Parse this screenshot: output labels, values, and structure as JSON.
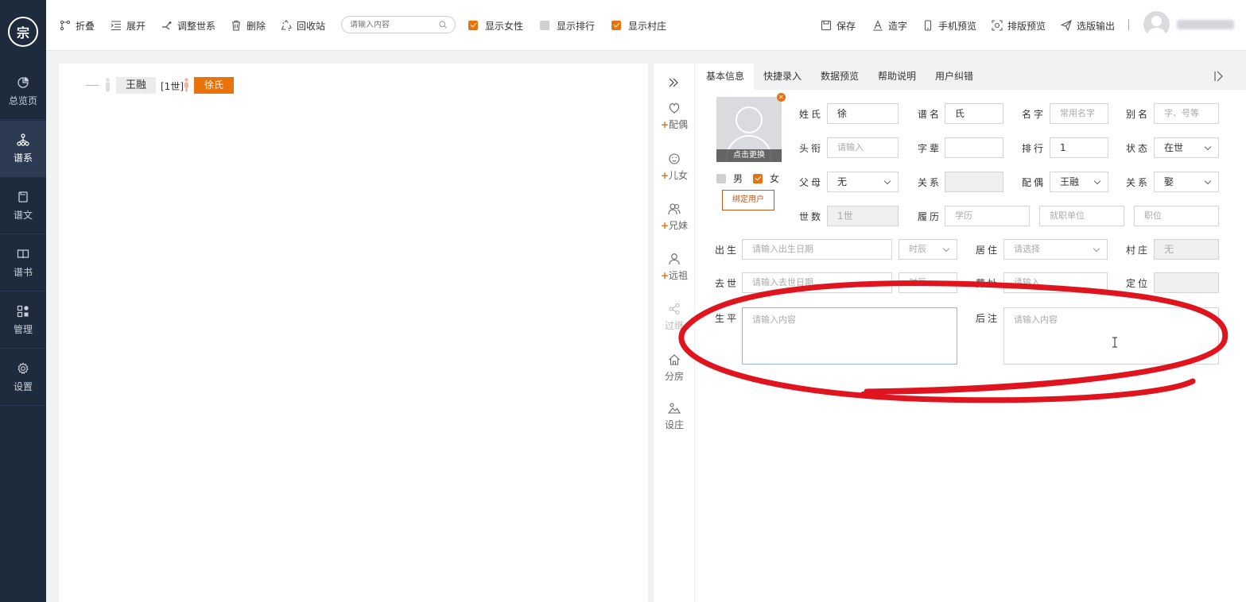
{
  "app": {
    "logo_text": "宗"
  },
  "sidebar": {
    "items": [
      {
        "label": "总览页",
        "icon": "pie-chart-icon",
        "active": false
      },
      {
        "label": "谱系",
        "icon": "tree-icon",
        "active": true
      },
      {
        "label": "谱文",
        "icon": "document-icon",
        "active": false
      },
      {
        "label": "谱书",
        "icon": "book-icon",
        "active": false
      },
      {
        "label": "管理",
        "icon": "grid-icon",
        "active": false
      },
      {
        "label": "设置",
        "icon": "gear-icon",
        "active": false
      }
    ]
  },
  "toolbar": {
    "fold": "折叠",
    "expand": "展开",
    "adjust_generation": "调整世系",
    "delete": "删除",
    "recycle": "回收站",
    "search_placeholder": "请输入内容",
    "show_female": "显示女性",
    "show_rank": "显示排行",
    "show_village": "显示村庄",
    "show_female_checked": true,
    "show_rank_checked": false,
    "show_village_checked": true,
    "save": "保存",
    "make_char": "造字",
    "mobile_preview": "手机预览",
    "layout_preview": "排版预览",
    "export": "选版输出"
  },
  "tree": {
    "root_name": "王融",
    "generation": "[1世]",
    "spouse_name": "徐氏"
  },
  "quickbar": [
    {
      "label": "配偶",
      "plus": "+",
      "icon": "spouse-icon",
      "disabled": false
    },
    {
      "label": "儿女",
      "plus": "+",
      "icon": "child-icon",
      "disabled": false
    },
    {
      "label": "兄妹",
      "plus": "+",
      "icon": "siblings-icon",
      "disabled": false
    },
    {
      "label": "远祖",
      "plus": "+",
      "icon": "ancestor-icon",
      "disabled": false
    },
    {
      "label": "过继",
      "plus": "",
      "icon": "share-icon",
      "disabled": true
    },
    {
      "label": "分房",
      "plus": "",
      "icon": "home-icon",
      "disabled": false
    },
    {
      "label": "设庄",
      "plus": "",
      "icon": "landscape-icon",
      "disabled": false
    }
  ],
  "tabs": [
    "基本信息",
    "快捷录入",
    "数据预览",
    "帮助说明",
    "用户纠错"
  ],
  "form": {
    "photo_change": "点击更换",
    "male": "男",
    "female": "女",
    "male_checked": false,
    "female_checked": true,
    "bind_user": "绑定用户",
    "surname_label": "姓氏",
    "surname": "徐",
    "pu_name_label": "谱名",
    "pu_name": "氏",
    "given_name_label": "名字",
    "given_name_ph": "常用名字",
    "alias_label": "别名",
    "alias_ph": "字、号等",
    "title_label": "头衔",
    "title_ph": "请输入",
    "zibei_label": "字辈",
    "zibei": "",
    "rank_label": "排行",
    "rank": "1",
    "status_label": "状态",
    "status": "在世",
    "parent_label": "父母",
    "parent": "无",
    "relation_label": "关系",
    "relation": "",
    "spouse_label": "配偶",
    "spouse": "王融",
    "relation2_label": "关系",
    "relation2": "娶",
    "gen_label": "世数",
    "gen": "1世",
    "resume_label": "履历",
    "edu_ph": "学历",
    "work_ph": "就职单位",
    "position_ph": "职位",
    "birth_label": "出生",
    "birth_ph": "请输入出生日期",
    "time_ph": "时辰",
    "live_label": "居住",
    "live_ph": "请选择",
    "village_label": "村庄",
    "village": "无",
    "death_label": "去世",
    "death_ph": "请输入去世日期",
    "time2_ph": "时辰",
    "burial_label": "葬址",
    "burial_ph": "请输入",
    "locate_label": "定位",
    "locate": "",
    "life_label": "生平",
    "life_ph": "请输入内容",
    "note_label": "后注",
    "note_ph": "请输入内容"
  },
  "colors": {
    "accent": "#e8720c",
    "sidebar": "#1e2b3d",
    "annotation": "#e0141e"
  }
}
